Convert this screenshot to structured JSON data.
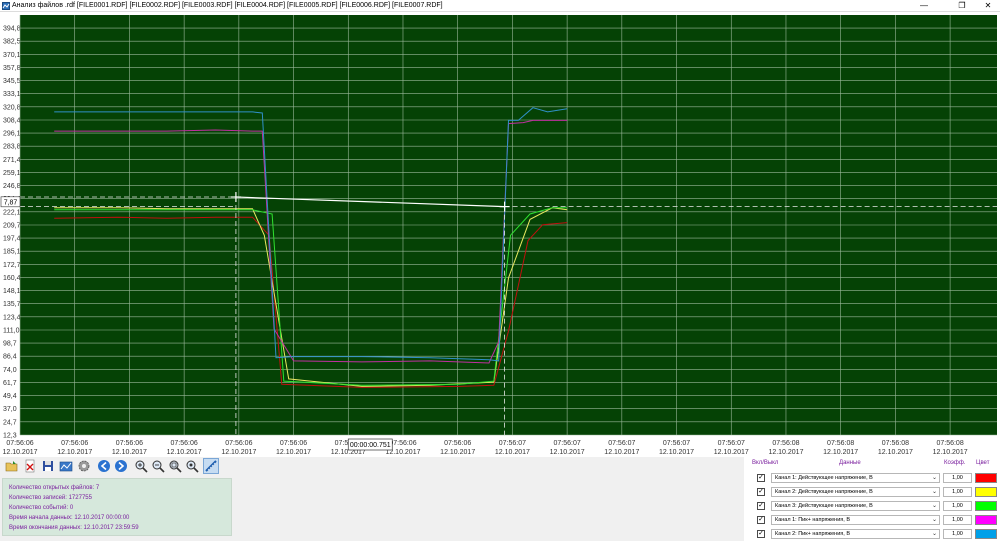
{
  "window": {
    "title": "Анализ файлов .rdf [FILE0001.RDF] [FILE0002.RDF] [FILE0003.RDF] [FILE0004.RDF] [FILE0005.RDF] [FILE0006.RDF] [FILE0007.RDF]",
    "minimize_label": "—",
    "maximize_label": "❐",
    "close_label": "✕"
  },
  "colors": {
    "plot_background": "#054205",
    "grid": "#9bb89b",
    "cursor": "#e8e8e8",
    "channel_1_rms": "#ff0000",
    "channel_2_rms": "#ffff00",
    "channel_3_rms": "#00ff00",
    "channel_1_peak": "#ff00ff",
    "channel_2_peak": "#00a0e8"
  },
  "chart_data": {
    "type": "line",
    "ylim": [
      12.3,
      407.1
    ],
    "y_ticks": [
      "12,3",
      "24,7",
      "37,0",
      "49,4",
      "61,7",
      "74,0",
      "86,4",
      "98,7",
      "111,0",
      "123,4",
      "135,7",
      "148,1",
      "160,4",
      "172,7",
      "185,1",
      "197,4",
      "209,7",
      "222,1",
      "234,4",
      "246,8",
      "259,1",
      "271,4",
      "283,8",
      "296,1",
      "308,4",
      "320,8",
      "333,1",
      "345,5",
      "357,8",
      "370,1",
      "382,5",
      "394,8"
    ],
    "x_range": [
      0,
      1.0
    ],
    "x_ticks": [
      {
        "t": 0.0,
        "time": "07:56:06",
        "date": "12.10.2017"
      },
      {
        "t": 0.056,
        "time": "07:56:06",
        "date": "12.10.2017"
      },
      {
        "t": 0.112,
        "time": "07:56:06",
        "date": "12.10.2017"
      },
      {
        "t": 0.168,
        "time": "07:56:06",
        "date": "12.10.2017"
      },
      {
        "t": 0.224,
        "time": "07:56:06",
        "date": "12.10.2017"
      },
      {
        "t": 0.28,
        "time": "07:56:06",
        "date": "12.10.2017"
      },
      {
        "t": 0.336,
        "time": "07:56:06",
        "date": "12.10.2017"
      },
      {
        "t": 0.392,
        "time": "07:56:06",
        "date": "12.10.2017"
      },
      {
        "t": 0.448,
        "time": "07:56:06",
        "date": "12.10.2017"
      },
      {
        "t": 0.504,
        "time": "07:56:07",
        "date": "12.10.2017"
      },
      {
        "t": 0.56,
        "time": "07:56:07",
        "date": "12.10.2017"
      },
      {
        "t": 0.616,
        "time": "07:56:07",
        "date": "12.10.2017"
      },
      {
        "t": 0.672,
        "time": "07:56:07",
        "date": "12.10.2017"
      },
      {
        "t": 0.728,
        "time": "07:56:07",
        "date": "12.10.2017"
      },
      {
        "t": 0.784,
        "time": "07:56:08",
        "date": "12.10.2017"
      },
      {
        "t": 0.84,
        "time": "07:56:08",
        "date": "12.10.2017"
      },
      {
        "t": 0.896,
        "time": "07:56:08",
        "date": "12.10.2017"
      },
      {
        "t": 0.952,
        "time": "07:56:08",
        "date": "12.10.2017"
      }
    ],
    "series": [
      {
        "name": "Канал 1: Действующее напряжение, В",
        "color": "#c01010",
        "x": [
          0.035,
          0.1,
          0.15,
          0.2,
          0.238,
          0.255,
          0.268,
          0.35,
          0.45,
          0.485,
          0.5,
          0.52,
          0.535,
          0.56
        ],
        "y": [
          216,
          217,
          216,
          217,
          217,
          200,
          60,
          57,
          58,
          59,
          110,
          195,
          210,
          212
        ]
      },
      {
        "name": "Канал 2: Действующее напряжение, В",
        "color": "#e8e860",
        "x": [
          0.035,
          0.1,
          0.15,
          0.2,
          0.238,
          0.25,
          0.275,
          0.35,
          0.42,
          0.485,
          0.5,
          0.522,
          0.545,
          0.56
        ],
        "y": [
          226,
          226,
          225,
          225,
          225,
          200,
          65,
          58,
          59,
          62,
          160,
          215,
          226,
          224
        ]
      },
      {
        "name": "Канал 3: Действующее напряжение, В",
        "color": "#30e030",
        "x": [
          0.035,
          0.1,
          0.15,
          0.2,
          0.238,
          0.258,
          0.27,
          0.35,
          0.45,
          0.485,
          0.502,
          0.522,
          0.545,
          0.56
        ],
        "y": [
          224,
          224,
          224,
          224,
          224,
          220,
          63,
          59,
          60,
          63,
          200,
          220,
          226,
          226
        ]
      },
      {
        "name": "Канал 1: Пик+ напряжения, В",
        "color": "#c030a0",
        "x": [
          0.035,
          0.1,
          0.15,
          0.2,
          0.238,
          0.248,
          0.26,
          0.28,
          0.35,
          0.42,
          0.48,
          0.49,
          0.5,
          0.515,
          0.525,
          0.56
        ],
        "y": [
          298,
          298,
          298,
          299,
          298,
          298,
          112,
          82,
          81,
          82,
          80,
          100,
          305,
          306,
          308,
          308
        ]
      },
      {
        "name": "Канал 2: Пик+ напряжения, В",
        "color": "#3090c8",
        "x": [
          0.035,
          0.1,
          0.15,
          0.2,
          0.238,
          0.248,
          0.262,
          0.28,
          0.35,
          0.42,
          0.48,
          0.49,
          0.5,
          0.51,
          0.525,
          0.54,
          0.56
        ],
        "y": [
          316,
          316,
          316,
          316,
          316,
          315,
          85,
          86,
          86,
          85,
          83,
          82,
          308,
          308,
          320,
          316,
          319
        ]
      }
    ],
    "cursors": [
      {
        "t": 0.221,
        "y": 236
      },
      {
        "t": 0.496,
        "y": 227
      }
    ],
    "cursor_value_label": "7,87",
    "cursor_time_label": "00:00:00.751"
  },
  "toolbar": {
    "buttons": [
      "open-file",
      "close-file",
      "save",
      "export",
      "settings",
      "back",
      "forward",
      "zoom-in",
      "zoom-out",
      "zoom-area",
      "zoom-reset",
      "measure"
    ]
  },
  "info": {
    "files_count": "Количество открытых файлов: 7",
    "records_count": "Количество записей: 1727755",
    "events_count": "Количество событий: 0",
    "data_start": "Время начала данных: 12.10.2017 00:00:00",
    "data_end": "Время окончания данных: 12.10.2017 23:59:59"
  },
  "channels": {
    "header_onoff": "Вкл/Выкл",
    "header_data": "Данные",
    "header_coef": "Коэфф.",
    "header_color": "Цвет",
    "rows": [
      {
        "name": "Канал 1: Действующее напряжение, В",
        "coef": "1,00",
        "color": "#ff0000",
        "checked": "✓"
      },
      {
        "name": "Канал 2: Действующее напряжение, В",
        "coef": "1,00",
        "color": "#ffff00",
        "checked": "✓"
      },
      {
        "name": "Канал 3: Действующее напряжение, В",
        "coef": "1,00",
        "color": "#00ff00",
        "checked": "✓"
      },
      {
        "name": "Канал 1: Пик+ напряжения, В",
        "coef": "1,00",
        "color": "#ff00ff",
        "checked": "✓"
      },
      {
        "name": "Канал 2: Пик+ напряжения, В",
        "coef": "1,00",
        "color": "#00a0e8",
        "checked": "✓"
      }
    ]
  }
}
